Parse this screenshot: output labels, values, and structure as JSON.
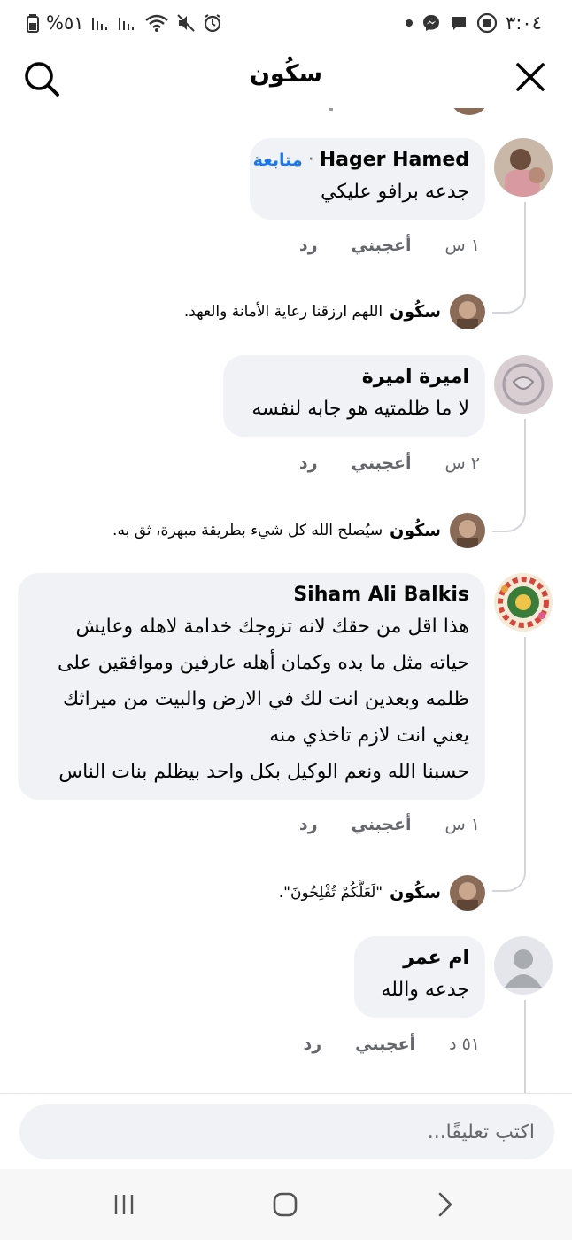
{
  "status_bar": {
    "time": "٣:٠٤",
    "battery": "%٥١"
  },
  "header": {
    "title": "سكُون"
  },
  "comments": [
    {
      "author": "Hager Hamed",
      "follow_label": "متابعة",
      "separator": "·",
      "text": "جدعه برافو عليكي",
      "time": "١ س",
      "like": "أعجبني",
      "reply": "رد",
      "page_reply": {
        "name": "سكُون",
        "text": "اللهم ارزقنا رعاية الأمانة والعهد."
      }
    },
    {
      "author": "اميرة اميرة",
      "text": "لا ما ظلمتيه هو جابه لنفسه",
      "time": "٢ س",
      "like": "أعجبني",
      "reply": "رد",
      "page_reply": {
        "name": "سكُون",
        "text": "سيُصلح الله كل شيء بطريقة مبهرة، ثق به."
      }
    },
    {
      "author": "Siham Ali Balkis",
      "lines": [
        "هذا اقل من حقك لانه تزوجك خدامة لاهله وعايش",
        "حياته مثل ما بده وكمان أهله عارفين وموافقين على",
        "ظلمه وبعدين انت لك في الارض والبيت من ميراثك",
        "يعني انت لازم تاخذي منه",
        "حسبنا الله ونعم الوكيل بكل واحد بيظلم بنات الناس"
      ],
      "time": "١ س",
      "like": "أعجبني",
      "reply": "رد",
      "page_reply": {
        "name": "سكُون",
        "text": "\"لَعَلَّكُمْ تُفْلِحُونَ\"."
      }
    },
    {
      "author": "ام عمر",
      "text": "جدعه والله",
      "time": "٥١ د",
      "like": "أعجبني",
      "reply": "رد"
    }
  ],
  "composer": {
    "placeholder": "اكتب تعليقًا..."
  },
  "colors": {
    "bubble": "#f0f2f5",
    "follow_link": "#1877f2",
    "meta_text": "#65676b",
    "thread_line": "#d3d5d9"
  },
  "icons": [
    "battery-icon",
    "signal-icon",
    "wifi-icon",
    "mute-icon",
    "alarm-icon",
    "messenger-icon",
    "chat-icon",
    "record-icon",
    "search-icon",
    "close-icon",
    "recent-apps-icon",
    "home-icon",
    "back-icon"
  ]
}
